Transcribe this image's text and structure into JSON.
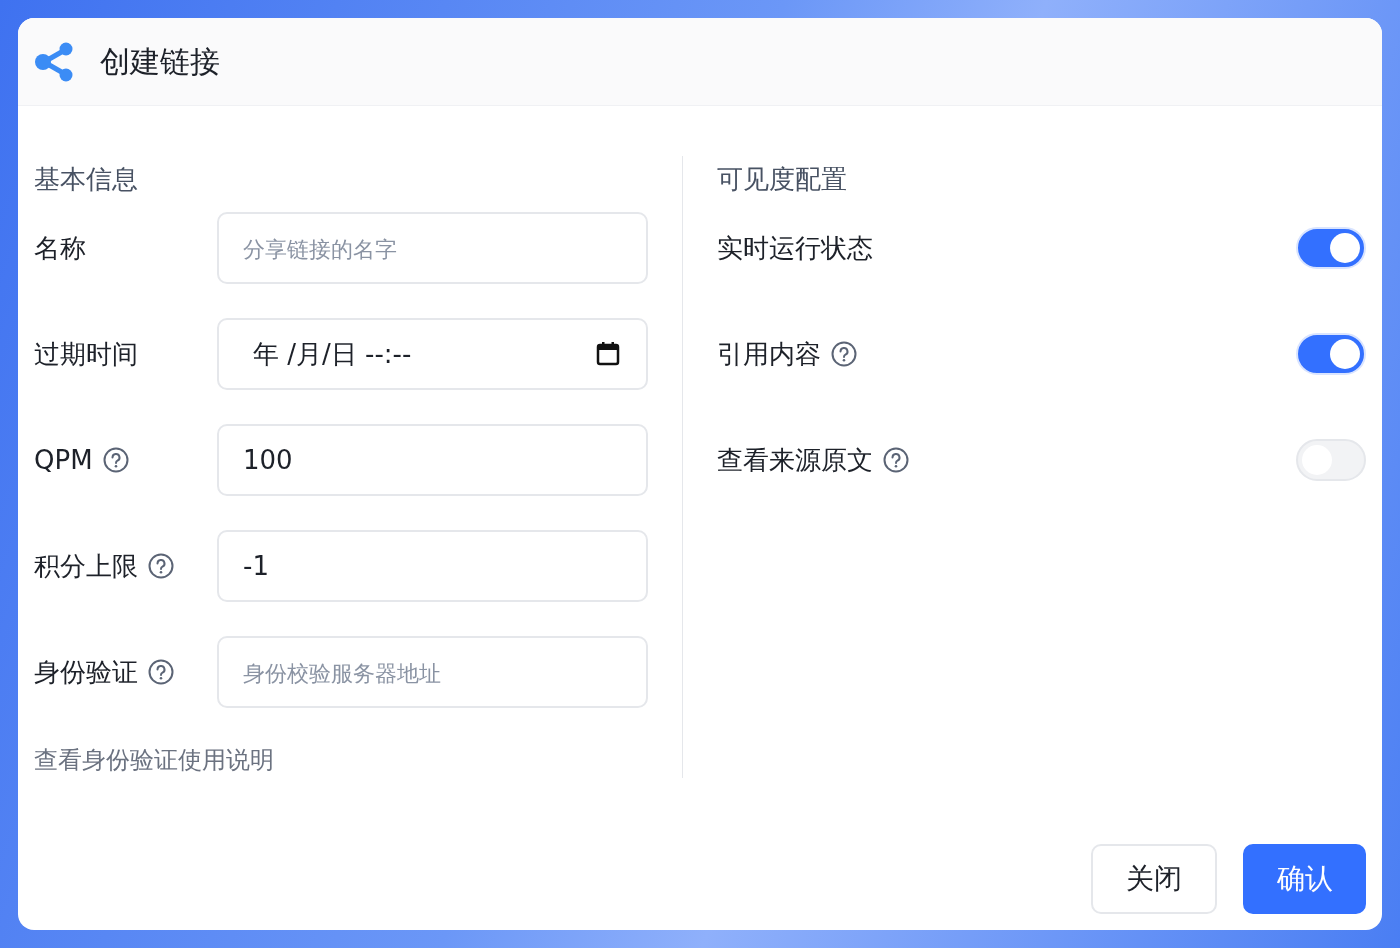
{
  "dialog": {
    "title": "创建链接"
  },
  "basic_info": {
    "heading": "基本信息",
    "fields": [
      {
        "label": "名称",
        "help": false,
        "kind": "text",
        "placeholder": "分享链接的名字"
      },
      {
        "label": "过期时间",
        "help": false,
        "kind": "datetime",
        "value": "年 /月/日 --:--"
      },
      {
        "label": "QPM",
        "help": true,
        "kind": "text",
        "value": "100"
      },
      {
        "label": "积分上限",
        "help": true,
        "kind": "text",
        "value": "-1"
      },
      {
        "label": "身份验证",
        "help": true,
        "kind": "text",
        "placeholder": "身份校验服务器地址"
      }
    ],
    "link": "查看身份验证使用说明"
  },
  "visibility": {
    "heading": "可见度配置",
    "switches": [
      {
        "label": "实时运行状态",
        "help": false,
        "on": true
      },
      {
        "label": "引用内容",
        "help": true,
        "on": true
      },
      {
        "label": "查看来源原文",
        "help": true,
        "on": false
      }
    ]
  },
  "buttons": [
    {
      "label": "关闭",
      "kind": "secondary"
    },
    {
      "label": "确认",
      "kind": "primary"
    }
  ]
}
